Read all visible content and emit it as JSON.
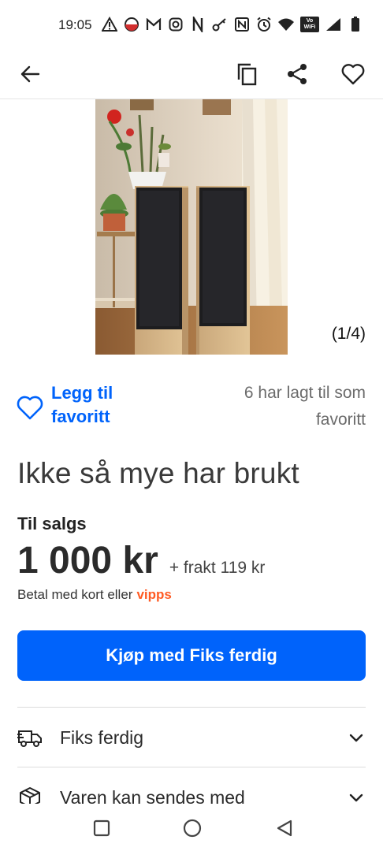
{
  "status_bar": {
    "time": "19:05",
    "icons": [
      "warning-icon",
      "record-icon",
      "gmail-icon",
      "instagram-icon",
      "n-icon",
      "key-icon",
      "nfc-icon",
      "alarm-icon",
      "wifi-icon",
      "vowifi-icon",
      "signal-icon",
      "battery-icon"
    ],
    "vowifi_text": "Vo WiFi"
  },
  "app_bar": {
    "back_icon": "arrow-left-icon",
    "copy_icon": "copy-icon",
    "share_icon": "share-icon",
    "favorite_icon": "heart-outline-icon"
  },
  "gallery": {
    "counter": "(1/4)"
  },
  "favorite": {
    "button_label": "Legg til favoritt",
    "count_text": "6 har lagt til som favoritt"
  },
  "listing": {
    "title": "Ikke så mye har brukt",
    "status": "Til salgs",
    "price": "1 000 kr",
    "shipping": "+ frakt 119 kr",
    "payment_text": "Betal med kort eller",
    "payment_brand": "vipps"
  },
  "buy_button": {
    "label": "Kjøp med Fiks ferdig"
  },
  "accordions": [
    {
      "label": "Fiks ferdig",
      "icon": "delivery-truck-icon"
    },
    {
      "label": "Varen kan sendes med",
      "icon": "package-icon"
    }
  ],
  "colors": {
    "accent": "#0063fb",
    "vipps": "#ff5b24",
    "text": "#2b2b2b",
    "muted": "#6b6b6b"
  },
  "nav_bar": {
    "items": [
      "recents-square-icon",
      "home-circle-icon",
      "back-triangle-icon"
    ]
  }
}
